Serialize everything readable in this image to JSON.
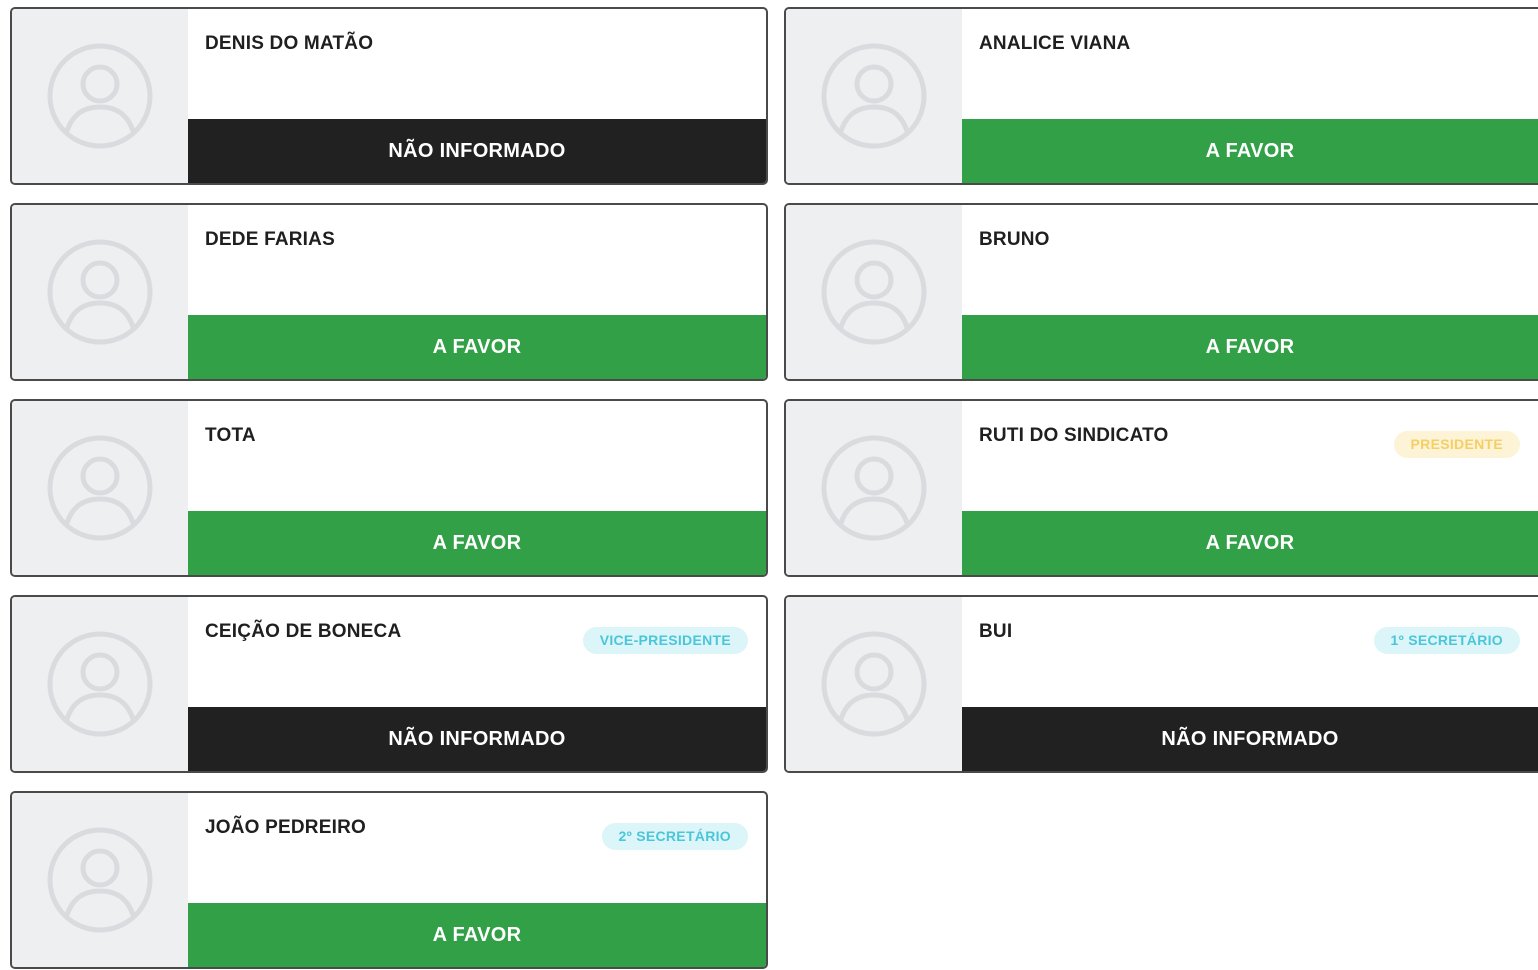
{
  "councillors": [
    {
      "name": "DENIS DO MATÃO",
      "role": "",
      "role_color": "",
      "vote": "NÃO INFORMADO",
      "vote_type": "nao",
      "photo_icon": "user-icon"
    },
    {
      "name": "ANALICE VIANA",
      "role": "",
      "role_color": "",
      "vote": "A FAVOR",
      "vote_type": "favor",
      "photo_icon": "user-icon"
    },
    {
      "name": "DEDE FARIAS",
      "role": "",
      "role_color": "",
      "vote": "A FAVOR",
      "vote_type": "favor",
      "photo_icon": "user-icon"
    },
    {
      "name": "BRUNO",
      "role": "",
      "role_color": "",
      "vote": "A FAVOR",
      "vote_type": "favor",
      "photo_icon": "user-icon"
    },
    {
      "name": "TOTA",
      "role": "",
      "role_color": "",
      "vote": "A FAVOR",
      "vote_type": "favor",
      "photo_icon": "user-icon"
    },
    {
      "name": "RUTI DO SINDICATO",
      "role": "PRESIDENTE",
      "role_color": "yellow",
      "vote": "A FAVOR",
      "vote_type": "favor",
      "photo_icon": "user-icon"
    },
    {
      "name": "CEIÇÃO DE BONECA",
      "role": "VICE-PRESIDENTE",
      "role_color": "cyan",
      "vote": "NÃO INFORMADO",
      "vote_type": "nao",
      "photo_icon": "user-icon"
    },
    {
      "name": "BUI",
      "role": "1º SECRETÁRIO",
      "role_color": "cyan",
      "vote": "NÃO INFORMADO",
      "vote_type": "nao",
      "photo_icon": "user-icon"
    },
    {
      "name": "JOÃO PEDREIRO",
      "role": "2º SECRETÁRIO",
      "role_color": "cyan",
      "vote": "A FAVOR",
      "vote_type": "favor",
      "photo_icon": "user-icon"
    }
  ],
  "colors": {
    "favor": "#31a047",
    "nao": "#212121",
    "role_cyan_bg": "#dcf5f8",
    "role_cyan_text": "#4ac6db",
    "role_yellow_bg": "#fdf3d7",
    "role_yellow_text": "#f6cf63",
    "photo_bg": "#eeeff1"
  }
}
